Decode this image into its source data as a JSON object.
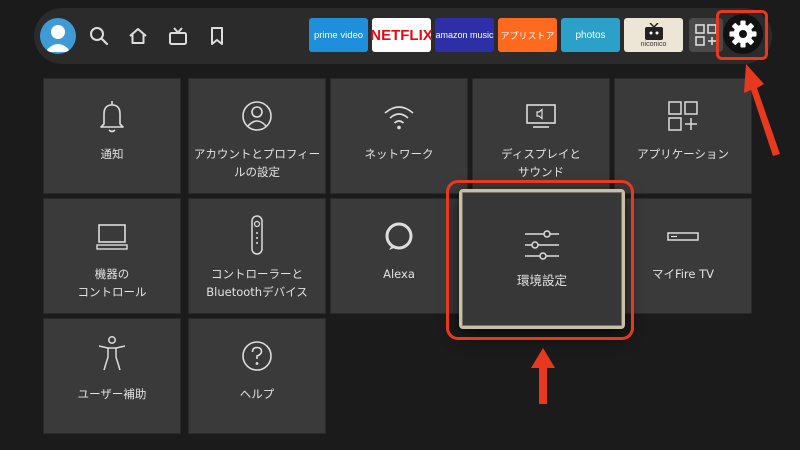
{
  "colors": {
    "background": "#1b1b1b",
    "tile": "#3a3a3a",
    "highlight": "#e8391f",
    "focus_border": "#c8bfa7"
  },
  "topbar": {
    "nav_icons": [
      "search-icon",
      "home-icon",
      "live-tv-icon",
      "bookmark-icon"
    ],
    "apps": [
      {
        "label": "prime video",
        "icon": "prime-video-logo"
      },
      {
        "label": "NETFLIX",
        "icon": "netflix-logo"
      },
      {
        "label": "amazon music",
        "icon": "amazon-music-logo"
      },
      {
        "label": "アプリストア",
        "icon": "appstore-logo"
      },
      {
        "label": "photos",
        "icon": "photos-logo"
      },
      {
        "label": "niconico",
        "icon": "niconico-logo"
      }
    ],
    "apps_grid_icon": "apps-grid-plus-icon",
    "settings_icon": "gear-icon"
  },
  "settings": {
    "tiles": [
      {
        "label": "通知",
        "icon": "bell-icon"
      },
      {
        "label": "アカウントとプロフィー\nルの設定",
        "icon": "profile-icon"
      },
      {
        "label": "ネットワーク",
        "icon": "wifi-icon"
      },
      {
        "label": "ディスプレイと\nサウンド",
        "icon": "display-sound-icon"
      },
      {
        "label": "アプリケーション",
        "icon": "applications-icon"
      },
      {
        "label": "機器の\nコントロール",
        "icon": "tv-device-icon"
      },
      {
        "label": "コントローラーと\nBluetoothデバイス",
        "icon": "remote-icon"
      },
      {
        "label": "Alexa",
        "icon": "alexa-icon"
      },
      {
        "label": "環境設定",
        "icon": "sliders-icon",
        "focused": true
      },
      {
        "label": "マイFire TV",
        "icon": "fire-tv-stick-icon"
      },
      {
        "label": "ユーザー補助",
        "icon": "accessibility-icon"
      },
      {
        "label": "ヘルプ",
        "icon": "help-icon"
      }
    ]
  }
}
